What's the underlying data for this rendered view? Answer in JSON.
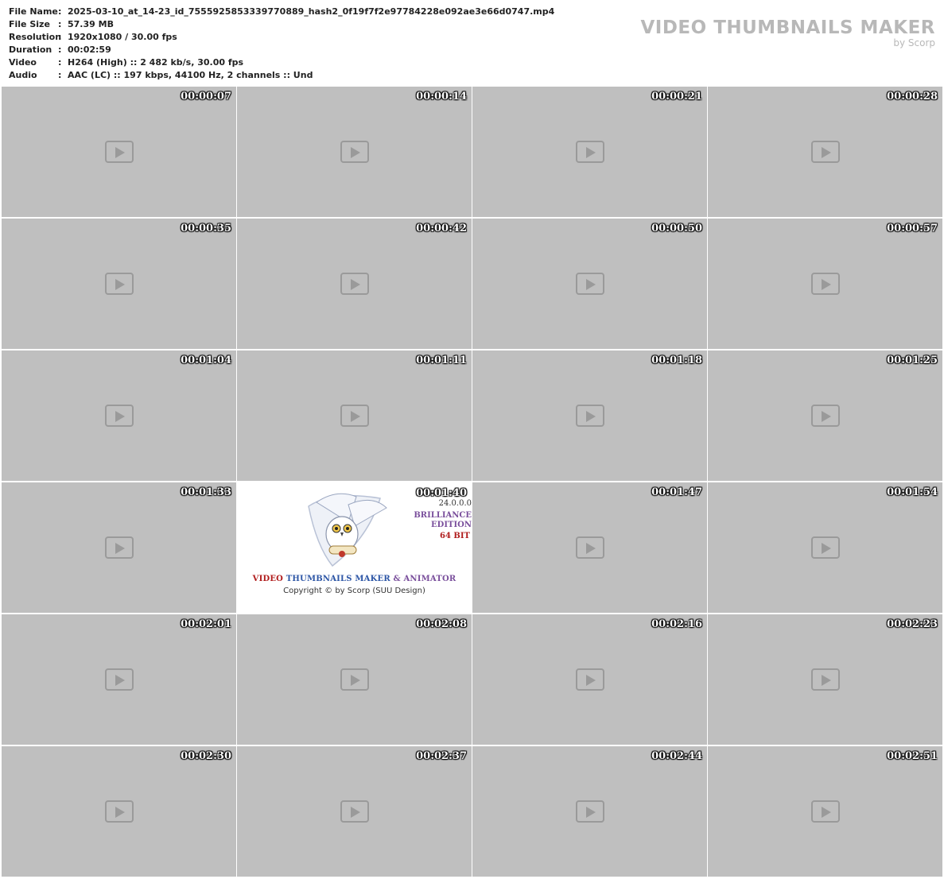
{
  "header": {
    "fields": [
      {
        "label": "File Name",
        "value": "2025-03-10_at_14-23_id_7555925853339770889_hash2_0f19f7f2e97784228e092ae3e66d0747.mp4"
      },
      {
        "label": "File Size",
        "value": "57.39 MB"
      },
      {
        "label": "Resolution",
        "value": "1920x1080 / 30.00 fps"
      },
      {
        "label": "Duration",
        "value": "00:02:59"
      },
      {
        "label": "Video",
        "value": "H264 (High) :: 2 482 kb/s, 30.00 fps"
      },
      {
        "label": "Audio",
        "value": "AAC (LC) :: 197 kbps, 44100 Hz, 2 channels :: Und"
      }
    ],
    "separator": ":"
  },
  "watermark": {
    "title": "VIDEO THUMBNAILS MAKER",
    "subtitle": "by Scorp"
  },
  "thumbnails": [
    {
      "time": "00:00:07"
    },
    {
      "time": "00:00:14"
    },
    {
      "time": "00:00:21"
    },
    {
      "time": "00:00:28"
    },
    {
      "time": "00:00:35"
    },
    {
      "time": "00:00:42"
    },
    {
      "time": "00:00:50"
    },
    {
      "time": "00:00:57"
    },
    {
      "time": "00:01:04"
    },
    {
      "time": "00:01:11"
    },
    {
      "time": "00:01:18"
    },
    {
      "time": "00:01:25"
    },
    {
      "time": "00:01:33"
    },
    {
      "time": "00:01:40"
    },
    {
      "time": "00:01:47"
    },
    {
      "time": "00:01:54"
    },
    {
      "time": "00:02:01"
    },
    {
      "time": "00:02:08"
    },
    {
      "time": "00:02:16"
    },
    {
      "time": "00:02:23"
    },
    {
      "time": "00:02:30"
    },
    {
      "time": "00:02:37"
    },
    {
      "time": "00:02:44"
    },
    {
      "time": "00:02:51"
    }
  ],
  "splash": {
    "version": "24.0.0.0",
    "edition_line1": "BRILLIANCE",
    "edition_line2": "EDITION",
    "bits": "64 BIT",
    "product_w1": "VIDEO",
    "product_w2": "THUMBNAILS MAKER",
    "product_w3": "& ANIMATOR",
    "copyright": "Copyright © by Scorp (SUU Design)"
  },
  "colors": {
    "placeholder": "#bfbfbf",
    "watermark": "#b8b8b8",
    "timestamp": "#ffffff",
    "brand_red": "#b01c1c",
    "brand_blue": "#2d56a6",
    "brand_purple": "#7a4f9c"
  }
}
